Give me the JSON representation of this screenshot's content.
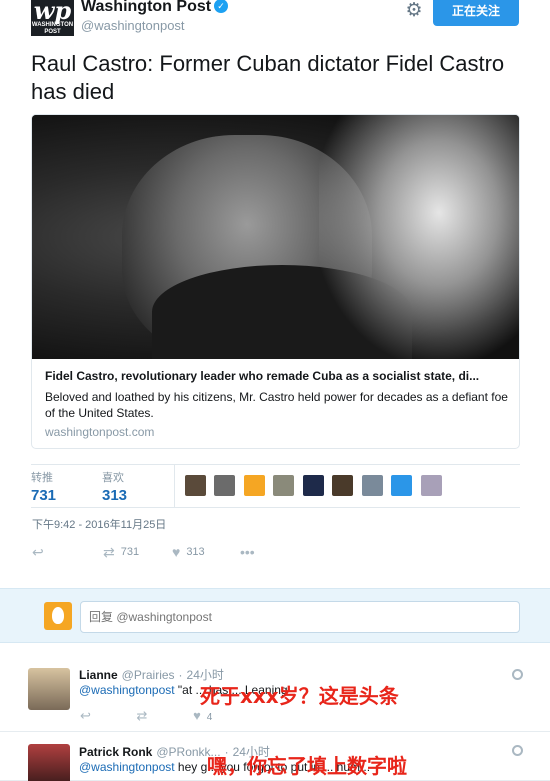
{
  "account": {
    "name": "Washington Post",
    "handle": "@washingtonpost",
    "logo_text": "wp",
    "logo_subtext": "WASHINGTON POST",
    "follow_label": "正在关注"
  },
  "tweet": {
    "text": "Raul Castro: Former Cuban dictator Fidel Castro has died",
    "card": {
      "title": "Fidel Castro, revolutionary leader who remade Cuba as a socialist state, di...",
      "description": "Beloved and loathed by his citizens, Mr. Castro held power for decades as a defiant foe of the United States.",
      "domain": "washingtonpost.com"
    },
    "stats": {
      "retweets_label": "转推",
      "retweets": "731",
      "likes_label": "喜欢",
      "likes": "313"
    },
    "timestamp": "下午9:42 - 2016年11月25日",
    "actions": {
      "retweet_count": "731",
      "like_count": "313"
    }
  },
  "reply_box": {
    "placeholder": "回复 @washingtonpost"
  },
  "replies": [
    {
      "name": "Lianne",
      "handle": "@Prairies",
      "time": "24小时",
      "mention": "@washingtonpost",
      "text": "\"at ... has ... Leaning",
      "like_count": "4",
      "overlay": "死于xxx岁？这是头条"
    },
    {
      "name": "Patrick Ronk",
      "handle": "@PRonkk...",
      "time": "24小时",
      "mention": "@washingtonpost",
      "text": "hey g... you forgot to put in ... num...",
      "overlay": "嘿，你忘了填上数字啦"
    }
  ],
  "colors": {
    "accent": "#1da1f2",
    "follow_button": "#2b96e8",
    "overlay_red": "#e8251a"
  }
}
